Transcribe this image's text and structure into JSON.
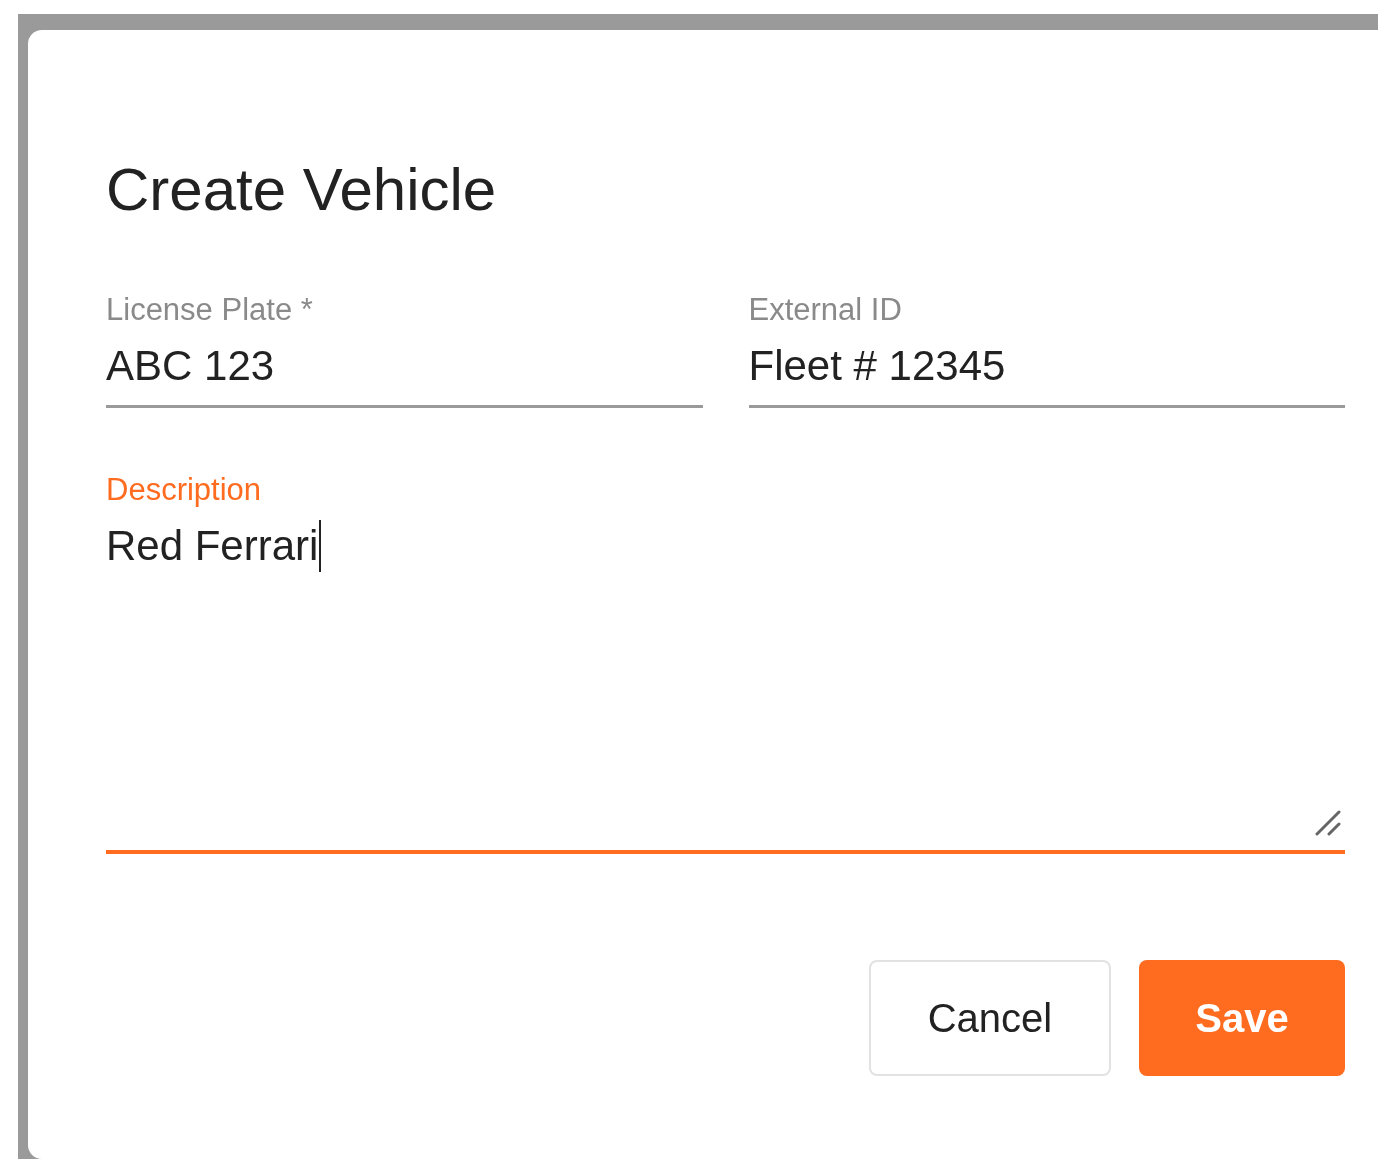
{
  "dialog": {
    "title": "Create Vehicle"
  },
  "fields": [
    {
      "kind": "text",
      "label": "License Plate *",
      "value": "ABC 123",
      "focused": false
    },
    {
      "kind": "text",
      "label": "External ID",
      "value": "Fleet # 12345",
      "focused": false
    },
    {
      "kind": "textarea",
      "label": "Description",
      "value": "Red Ferrari",
      "focused": true
    }
  ],
  "buttons": [
    {
      "kind": "secondary",
      "label": "Cancel"
    },
    {
      "kind": "primary",
      "label": "Save"
    }
  ]
}
